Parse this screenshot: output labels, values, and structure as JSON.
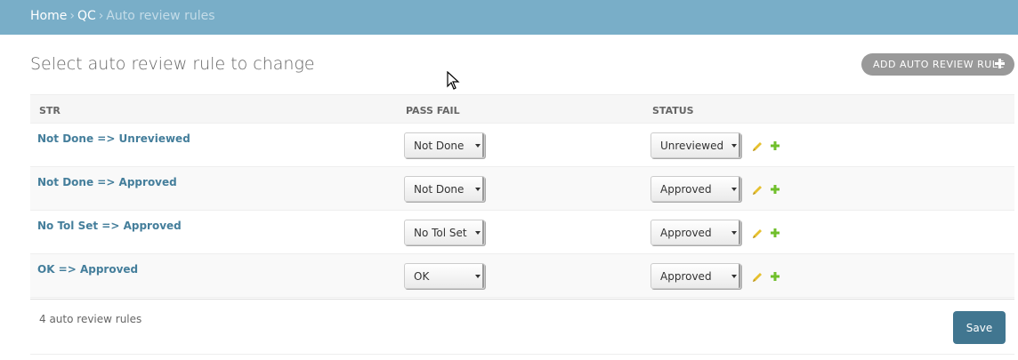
{
  "breadcrumbs": {
    "home": "Home",
    "sep1": "›",
    "section": "QC",
    "sep2": "›",
    "current": "Auto review rules"
  },
  "page": {
    "title": "Select auto review rule to change",
    "add_button": "ADD AUTO REVIEW RULE"
  },
  "table": {
    "columns": [
      "STR",
      "PASS FAIL",
      "STATUS"
    ],
    "rows": [
      {
        "str": "Not Done => Unreviewed",
        "pass_fail": "Not Done",
        "status": "Unreviewed"
      },
      {
        "str": "Not Done => Approved",
        "pass_fail": "Not Done",
        "status": "Approved"
      },
      {
        "str": "No Tol Set => Approved",
        "pass_fail": "No Tol Set",
        "status": "Approved"
      },
      {
        "str": "OK => Approved",
        "pass_fail": "OK",
        "status": "Approved"
      }
    ]
  },
  "footer": {
    "count": "4 auto review rules",
    "save": "Save"
  },
  "colors": {
    "header_bg": "#79aec8",
    "link": "#447e9b",
    "save_bg": "#417690",
    "pencil": "#e6c02e",
    "plus": "#70bf2b"
  },
  "icons": [
    "plus-icon",
    "pencil-icon",
    "dropdown-caret-icon",
    "mouse-cursor-icon"
  ]
}
